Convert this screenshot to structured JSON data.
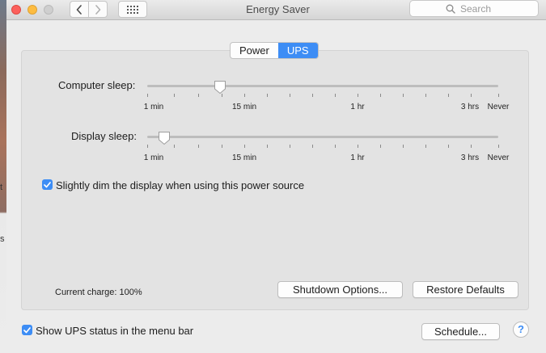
{
  "window": {
    "title": "Energy Saver",
    "search_placeholder": "Search"
  },
  "tabs": [
    {
      "label": "Power",
      "selected": false
    },
    {
      "label": "UPS",
      "selected": true
    }
  ],
  "sliders": {
    "computer_sleep": {
      "label": "Computer sleep:",
      "value": "15 min"
    },
    "display_sleep": {
      "label": "Display sleep:",
      "value": "1 min"
    },
    "tick_labels": [
      "1 min",
      "15 min",
      "1 hr",
      "3 hrs",
      "Never"
    ]
  },
  "options": {
    "dim_display": {
      "label": "Slightly dim the display when using this power source",
      "checked": true
    },
    "show_ups_status": {
      "label": "Show UPS status in the menu bar",
      "checked": true
    }
  },
  "status": {
    "current_charge": "Current charge: 100%"
  },
  "buttons": {
    "shutdown_options": "Shutdown Options...",
    "restore_defaults": "Restore Defaults",
    "schedule": "Schedule...",
    "help": "?"
  },
  "colors": {
    "accent": "#3d8df5"
  },
  "icons": [
    "back-icon",
    "forward-icon",
    "grid-icon",
    "search-icon",
    "checkmark-icon",
    "help-icon"
  ]
}
